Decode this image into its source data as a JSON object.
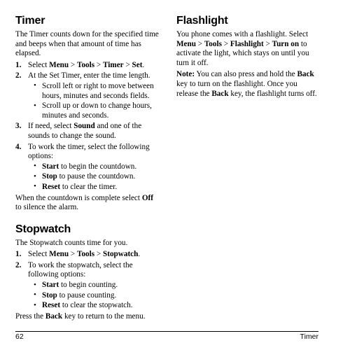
{
  "document": {
    "page_number": "62",
    "running_head": "Timer"
  },
  "left_column": {
    "timer": {
      "heading": "Timer",
      "intro": "The Timer counts down for the specified time and beeps when that amount of time has elapsed.",
      "steps": [
        {
          "number": "1.",
          "text_parts": [
            {
              "text": "Select ",
              "bold": false
            },
            {
              "text": "Menu",
              "bold": true
            },
            {
              "text": " > ",
              "bold": false
            },
            {
              "text": "Tools",
              "bold": true
            },
            {
              "text": " > ",
              "bold": false
            },
            {
              "text": "Timer",
              "bold": true
            },
            {
              "text": " > ",
              "bold": false
            },
            {
              "text": "Set",
              "bold": true
            },
            {
              "text": ".",
              "bold": false
            }
          ]
        },
        {
          "number": "2.",
          "text_parts": [
            {
              "text": "At the Set Timer, enter the time length.",
              "bold": false
            }
          ],
          "bullets": [
            [
              {
                "text": "Scroll left or right to move between hours, minutes and seconds fields.",
                "bold": false
              }
            ],
            [
              {
                "text": "Scroll up or down to change hours, minutes and seconds.",
                "bold": false
              }
            ]
          ]
        },
        {
          "number": "3.",
          "text_parts": [
            {
              "text": "If need, select ",
              "bold": false
            },
            {
              "text": "Sound",
              "bold": true
            },
            {
              "text": " and one of the sounds to change the sound.",
              "bold": false
            }
          ]
        },
        {
          "number": "4.",
          "text_parts": [
            {
              "text": "To work the timer, select the following options:",
              "bold": false
            }
          ],
          "bullets": [
            [
              {
                "text": "Start",
                "bold": true
              },
              {
                "text": " to begin the countdown.",
                "bold": false
              }
            ],
            [
              {
                "text": "Stop",
                "bold": true
              },
              {
                "text": " to pause the countdown.",
                "bold": false
              }
            ],
            [
              {
                "text": "Reset",
                "bold": true
              },
              {
                "text": " to clear the timer.",
                "bold": false
              }
            ]
          ]
        }
      ],
      "closing_parts": [
        {
          "text": "When the countdown is complete select ",
          "bold": false
        },
        {
          "text": "Off",
          "bold": true
        },
        {
          "text": " to silence the alarm.",
          "bold": false
        }
      ]
    },
    "stopwatch": {
      "heading": "Stopwatch",
      "intro": "The Stopwatch counts time for you.",
      "steps": [
        {
          "number": "1.",
          "text_parts": [
            {
              "text": "Select ",
              "bold": false
            },
            {
              "text": "Menu",
              "bold": true
            },
            {
              "text": " > ",
              "bold": false
            },
            {
              "text": "Tools",
              "bold": true
            },
            {
              "text": " > ",
              "bold": false
            },
            {
              "text": "Stopwatch",
              "bold": true
            },
            {
              "text": ".",
              "bold": false
            }
          ]
        },
        {
          "number": "2.",
          "text_parts": [
            {
              "text": "To work the stopwatch, select the following options:",
              "bold": false
            }
          ],
          "bullets": [
            [
              {
                "text": "Start",
                "bold": true
              },
              {
                "text": " to begin counting.",
                "bold": false
              }
            ],
            [
              {
                "text": "Stop",
                "bold": true
              },
              {
                "text": " to pause counting.",
                "bold": false
              }
            ],
            [
              {
                "text": "Reset",
                "bold": true
              },
              {
                "text": " to clear the stopwatch.",
                "bold": false
              }
            ]
          ]
        }
      ],
      "closing_parts": [
        {
          "text": "Press the ",
          "bold": false
        },
        {
          "text": "Back",
          "bold": true
        },
        {
          "text": " key to return to the menu.",
          "bold": false
        }
      ]
    }
  },
  "right_column": {
    "flashlight": {
      "heading": "Flashlight",
      "intro_parts": [
        {
          "text": "You phone comes with a flashlight. Select ",
          "bold": false
        },
        {
          "text": "Menu",
          "bold": true
        },
        {
          "text": " > ",
          "bold": false
        },
        {
          "text": "Tools",
          "bold": true
        },
        {
          "text": " > ",
          "bold": false
        },
        {
          "text": "Flashlight",
          "bold": true
        },
        {
          "text": " > ",
          "bold": false
        },
        {
          "text": "Turn on",
          "bold": true
        },
        {
          "text": " to activate the light, which stays on until you turn it off.",
          "bold": false
        }
      ],
      "note_parts": [
        {
          "text": "Note:",
          "bold": true
        },
        {
          "text": " You can also press and hold the ",
          "bold": false
        },
        {
          "text": "Back",
          "bold": true
        },
        {
          "text": " key to turn on the flashlight. Once you release the ",
          "bold": false
        },
        {
          "text": "Back",
          "bold": true
        },
        {
          "text": " key, the flashlight turns off.",
          "bold": false
        }
      ]
    }
  }
}
